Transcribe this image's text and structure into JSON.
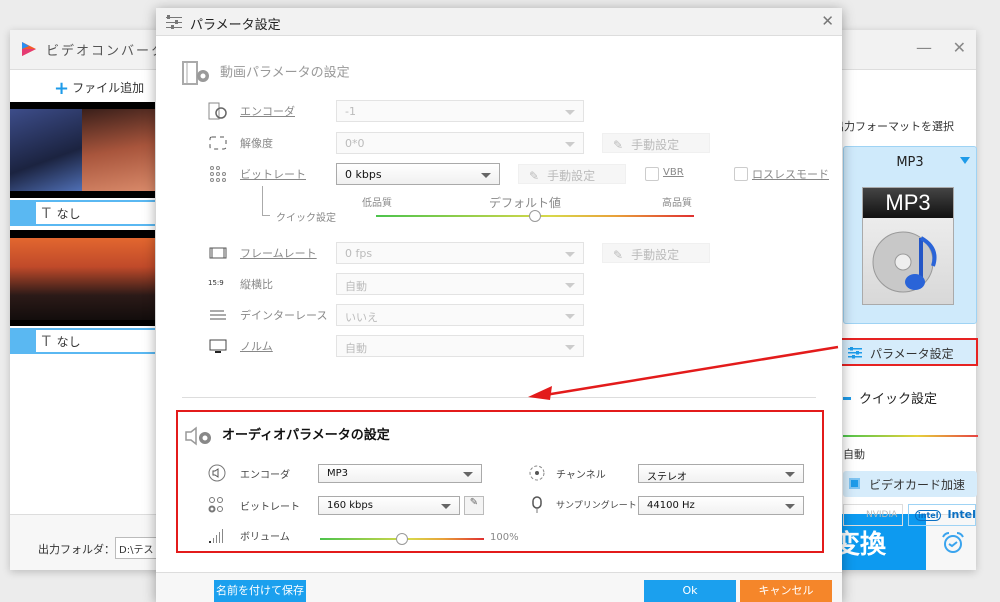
{
  "app": {
    "title": "ビデオコンバータ",
    "minimize_glyph": "—",
    "close_glyph": "✕",
    "add_file_label": "ファイル追加",
    "add_file_icon": "plus-icon",
    "files": [
      {
        "subtitle": "なし",
        "subtitle_icon": "T"
      },
      {
        "subtitle": "なし",
        "subtitle_icon": "T"
      }
    ],
    "output_folder_label": "出力フォルダ：",
    "output_folder_value": "D:\\テスト",
    "convert_label": "変換",
    "right_panel": {
      "format_select_label": "出力フォーマットを選択",
      "format_name": "MP3",
      "format_icon_text": "MP3",
      "param_settings_label": "パラメータ設定",
      "quick_settings_label": "クイック設定",
      "quick_auto_label": "自動",
      "gpu_accel_label": "ビデオカード加速",
      "nvidia_label": "NVIDIA",
      "intel_label": "Intel"
    }
  },
  "dialog": {
    "title": "パラメータ設定",
    "close_glyph": "✕",
    "video": {
      "section_title": "動画パラメータの設定",
      "encoder": {
        "label": "エンコーダ",
        "value": "-1"
      },
      "resolution": {
        "label": "解像度",
        "value": "0*0",
        "manual": "手動設定"
      },
      "bitrate": {
        "label": "ビットレート",
        "value": "0 kbps",
        "manual": "手動設定",
        "vbr": "VBR",
        "lossless": "ロスレスモード"
      },
      "quick": {
        "label": "クイック設定",
        "low": "低品質",
        "default": "デフォルト値",
        "high": "高品質",
        "position": 0.5
      },
      "framerate": {
        "label": "フレームレート",
        "value": "0 fps",
        "manual": "手動設定"
      },
      "aspect": {
        "label": "縦横比",
        "value": "自動",
        "icon_text": "15:9"
      },
      "deinterlace": {
        "label": "デインターレース",
        "value": "いいえ"
      },
      "norm": {
        "label": "ノルム",
        "value": "自動"
      }
    },
    "audio": {
      "section_title": "オーディオパラメータの設定",
      "encoder": {
        "label": "エンコーダ",
        "value": "MP3"
      },
      "channel": {
        "label": "チャンネル",
        "value": "ステレオ"
      },
      "bitrate": {
        "label": "ビットレート",
        "value": "160 kbps"
      },
      "sample_rate": {
        "label": "サンプリングレート",
        "value": "44100 Hz"
      },
      "volume": {
        "label": "ボリューム",
        "value": "100%",
        "position": 0.5
      }
    },
    "footer": {
      "save_as": "名前を付けて保存",
      "ok": "Ok",
      "cancel": "キャンセル"
    }
  },
  "colors": {
    "accent": "#1ba0ee",
    "cancel": "#f5862a",
    "highlight": "#e31b1b"
  }
}
